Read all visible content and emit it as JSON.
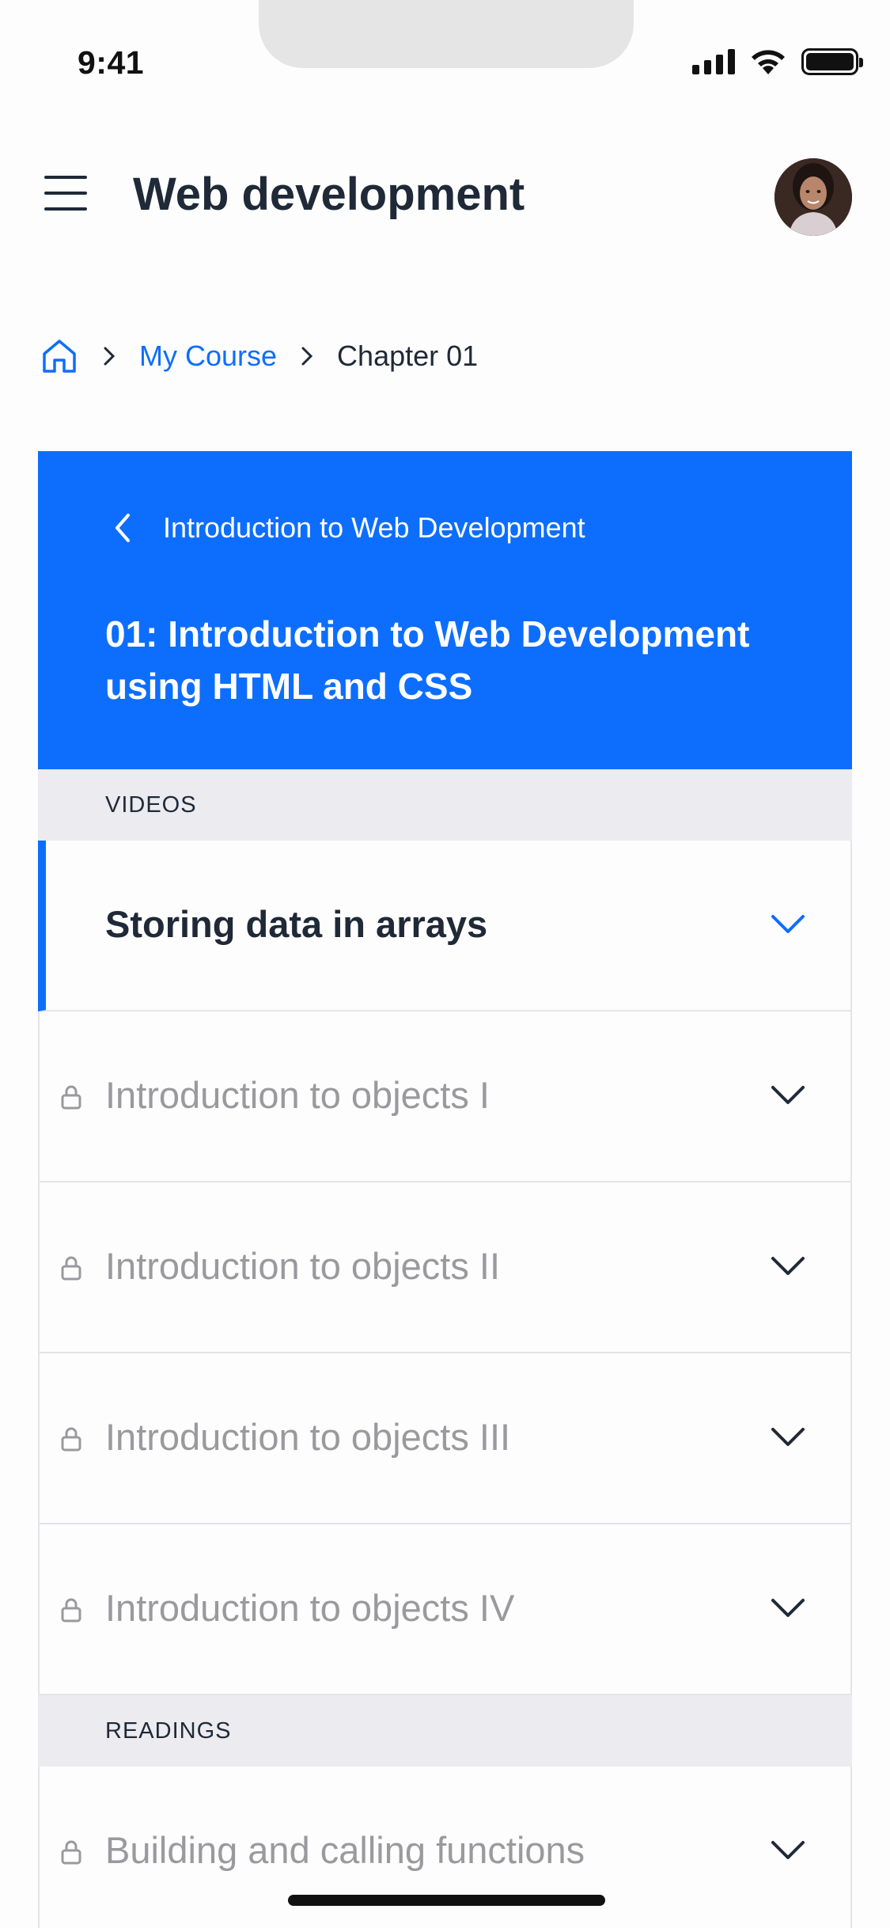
{
  "status_bar": {
    "time": "9:41"
  },
  "header": {
    "title": "Web development"
  },
  "breadcrumb": {
    "link": "My Course",
    "current": "Chapter 01"
  },
  "chapter": {
    "back_label": "Introduction to Web Development",
    "title": "01: Introduction to Web Development using HTML and CSS"
  },
  "sections": [
    {
      "label": "VIDEOS",
      "items": [
        {
          "label": "Storing data in arrays",
          "locked": false,
          "active": true
        },
        {
          "label": "Introduction to objects I",
          "locked": true,
          "active": false
        },
        {
          "label": "Introduction to objects II",
          "locked": true,
          "active": false
        },
        {
          "label": "Introduction to objects III",
          "locked": true,
          "active": false
        },
        {
          "label": "Introduction to objects IV",
          "locked": true,
          "active": false
        }
      ]
    },
    {
      "label": "READINGS",
      "items": [
        {
          "label": "Building and calling functions",
          "locked": true,
          "active": false
        }
      ]
    }
  ],
  "colors": {
    "accent": "#0d6efd",
    "locked_text": "#9a9a9e",
    "section_bg": "#ebebf0"
  },
  "icons": [
    "menu-icon",
    "home-icon",
    "chevron-right-icon",
    "chevron-left-icon",
    "lock-icon",
    "chevron-down-icon"
  ]
}
